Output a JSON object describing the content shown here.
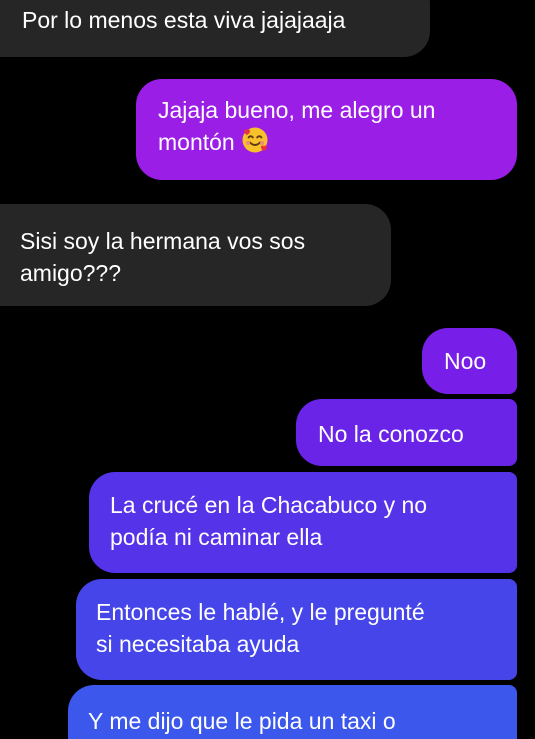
{
  "colors": {
    "background": "#000000",
    "incoming_bubble": "#262626",
    "text": "#ffffff",
    "outgoing_gradient_top": "#9b1ee6",
    "outgoing_gradient_bottom": "#3b57ec"
  },
  "messages": [
    {
      "direction": "incoming",
      "lines": [
        "Por lo menos esta viva jajajaaja"
      ]
    },
    {
      "direction": "outgoing",
      "lines": [
        "Jajaja bueno, me alegro un",
        "montón"
      ],
      "emoji": "smiling-face-with-hearts-icon"
    },
    {
      "direction": "incoming",
      "lines": [
        "Sisi soy la hermana vos sos",
        "amigo???"
      ]
    },
    {
      "direction": "outgoing",
      "lines": [
        "Noo"
      ]
    },
    {
      "direction": "outgoing",
      "lines": [
        "No la conozco"
      ]
    },
    {
      "direction": "outgoing",
      "lines": [
        "La crucé en la Chacabuco y no",
        "podía ni caminar ella"
      ]
    },
    {
      "direction": "outgoing",
      "lines": [
        "Entonces le hablé, y le pregunté",
        "si necesitaba ayuda"
      ]
    },
    {
      "direction": "outgoing",
      "lines": [
        "Y me dijo que le pida un taxi o"
      ]
    }
  ]
}
